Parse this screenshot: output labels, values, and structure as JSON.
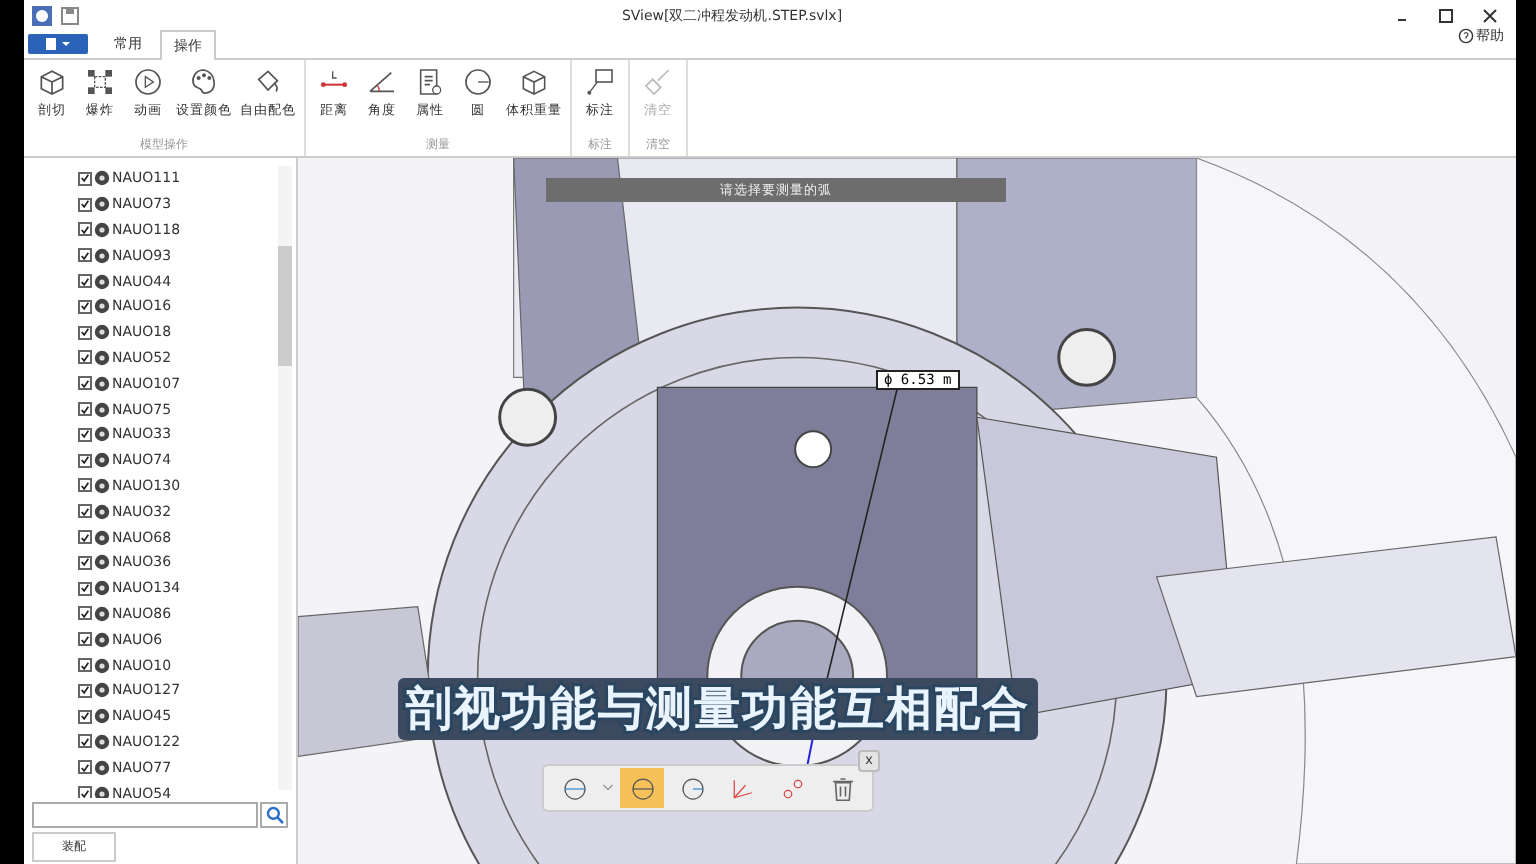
{
  "window": {
    "title": "SView[双二冲程发动机.STEP.svlx]",
    "help": "帮助"
  },
  "tabs": [
    {
      "label": "常用",
      "selected": false
    },
    {
      "label": "操作",
      "selected": true
    }
  ],
  "ribbon": {
    "groups": [
      {
        "label": "模型操作",
        "tools": [
          {
            "label": "剖切",
            "kind": "cube",
            "disabled": false
          },
          {
            "label": "爆炸",
            "kind": "explode",
            "disabled": false
          },
          {
            "label": "动画",
            "kind": "play",
            "disabled": false
          },
          {
            "label": "设置颜色",
            "kind": "palette",
            "disabled": false
          },
          {
            "label": "自由配色",
            "kind": "bucket",
            "disabled": false
          }
        ]
      },
      {
        "label": "测量",
        "tools": [
          {
            "label": "距离",
            "kind": "distance",
            "disabled": false
          },
          {
            "label": "角度",
            "kind": "angle",
            "disabled": false
          },
          {
            "label": "属性",
            "kind": "doc",
            "disabled": false
          },
          {
            "label": "圆",
            "kind": "circle",
            "disabled": false
          },
          {
            "label": "体积重量",
            "kind": "box",
            "disabled": false
          }
        ]
      },
      {
        "label": "标注",
        "tools": [
          {
            "label": "标注",
            "kind": "note",
            "disabled": false
          }
        ]
      },
      {
        "label": "清空",
        "tools": [
          {
            "label": "清空",
            "kind": "broom",
            "disabled": true
          }
        ]
      }
    ]
  },
  "tree": {
    "items": [
      {
        "label": "NAUO111",
        "checked": true
      },
      {
        "label": "NAUO73",
        "checked": true
      },
      {
        "label": "NAUO118",
        "checked": true
      },
      {
        "label": "NAUO93",
        "checked": true
      },
      {
        "label": "NAUO44",
        "checked": true
      },
      {
        "label": "NAUO16",
        "checked": true
      },
      {
        "label": "NAUO18",
        "checked": true
      },
      {
        "label": "NAUO52",
        "checked": true
      },
      {
        "label": "NAUO107",
        "checked": true
      },
      {
        "label": "NAUO75",
        "checked": true
      },
      {
        "label": "NAUO33",
        "checked": true
      },
      {
        "label": "NAUO74",
        "checked": true
      },
      {
        "label": "NAUO130",
        "checked": true
      },
      {
        "label": "NAUO32",
        "checked": true
      },
      {
        "label": "NAUO68",
        "checked": true
      },
      {
        "label": "NAUO36",
        "checked": true
      },
      {
        "label": "NAUO134",
        "checked": true
      },
      {
        "label": "NAUO86",
        "checked": true
      },
      {
        "label": "NAUO6",
        "checked": true
      },
      {
        "label": "NAUO10",
        "checked": true
      },
      {
        "label": "NAUO127",
        "checked": true
      },
      {
        "label": "NAUO45",
        "checked": true
      },
      {
        "label": "NAUO122",
        "checked": true
      },
      {
        "label": "NAUO77",
        "checked": true
      },
      {
        "label": "NAUO54",
        "checked": true
      }
    ],
    "bottom_tab": "装配"
  },
  "viewport": {
    "prompt": "请选择要测量的弧",
    "measurement": "ϕ 6.53 m",
    "caption": "剖视功能与测量功能互相配合",
    "toolbar": {
      "close": "x",
      "tools": [
        {
          "kind": "diameter",
          "selected": false
        },
        {
          "kind": "circle",
          "selected": true
        },
        {
          "kind": "radius",
          "selected": false
        },
        {
          "kind": "angle",
          "selected": false
        },
        {
          "kind": "points",
          "selected": false
        },
        {
          "kind": "trash",
          "selected": false
        }
      ]
    }
  }
}
